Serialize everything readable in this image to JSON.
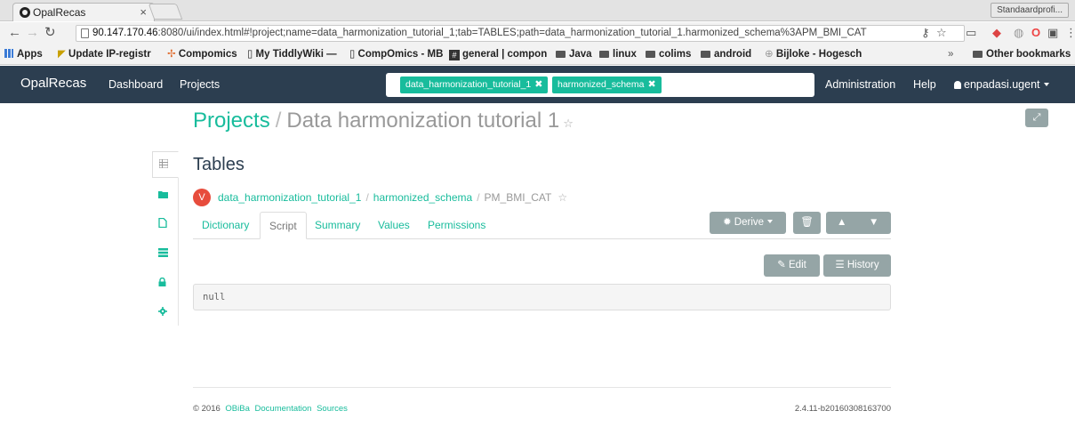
{
  "browser": {
    "tab_title": "OpalRecas",
    "tab_close": "×",
    "profile": "Standaardprofi...",
    "url_host": "90.147.170.46",
    "url_rest": ":8080/ui/index.html#!project;name=data_harmonization_tutorial_1;tab=TABLES;path=data_harmonization_tutorial_1.harmonized_schema%3APM_BMI_CAT",
    "bookmarks": [
      "Apps",
      "Update IP-registr",
      "Compomics",
      "My TiddlyWiki —",
      "CompOmics - MB",
      "general | compon",
      "Java",
      "linux",
      "colims",
      "android",
      "Bijloke - Hogesch"
    ],
    "overflow": "»",
    "other_bookmarks": "Other bookmarks"
  },
  "navbar": {
    "brand": "OpalRecas",
    "links": [
      "Dashboard",
      "Projects"
    ],
    "search_tags": [
      "data_harmonization_tutorial_1",
      "harmonized_schema"
    ],
    "tag_close": "✖",
    "right_links": [
      "Administration",
      "Help"
    ],
    "user": "enpadasi.ugent"
  },
  "page": {
    "crumb": "Projects",
    "separator": "/",
    "project_title": "Data harmonization tutorial 1",
    "star": "☆",
    "section_title": "Tables",
    "badge": "V",
    "breadcrumb": [
      "data_harmonization_tutorial_1",
      "harmonized_schema",
      "PM_BMI_CAT"
    ],
    "tabs": [
      "Dictionary",
      "Script",
      "Summary",
      "Values",
      "Permissions"
    ],
    "active_tab": "Script",
    "derive_label": "Derive",
    "edit_label": "Edit",
    "history_label": "History",
    "script_content": "null"
  },
  "footer": {
    "copyright": "© 2016",
    "links": [
      "OBiBa",
      "Documentation",
      "Sources"
    ],
    "version": "2.4.11-b20160308163700"
  },
  "colors": {
    "navbar": "#2c3e50",
    "accent": "#18bc9c",
    "badge": "#e74c3c",
    "button": "#95a5a6"
  }
}
